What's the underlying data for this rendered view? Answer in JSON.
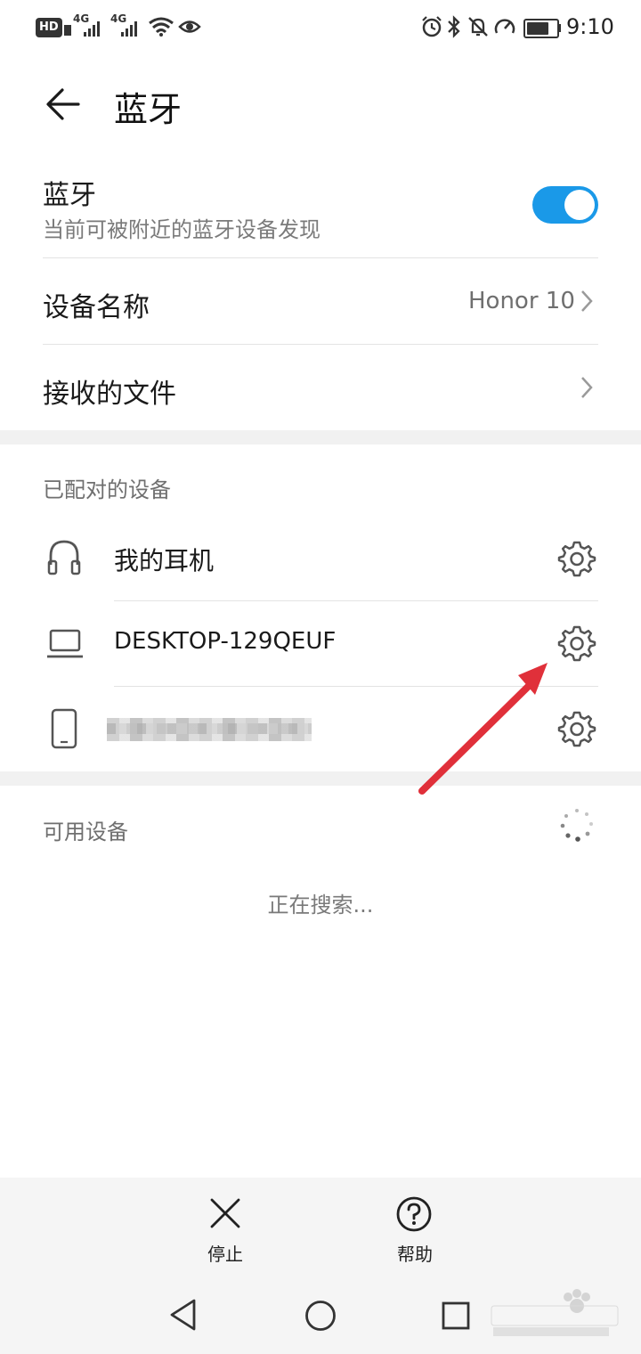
{
  "status_bar": {
    "hd_badge": "HD",
    "signal1_label": "4G",
    "signal2_label": "4G",
    "time": "9:10"
  },
  "header": {
    "title": "蓝牙"
  },
  "bluetooth": {
    "title": "蓝牙",
    "subtitle": "当前可被附近的蓝牙设备发现",
    "enabled": true
  },
  "device_name": {
    "label": "设备名称",
    "value": "Honor 10"
  },
  "received_files": {
    "label": "接收的文件"
  },
  "paired": {
    "section_label": "已配对的设备",
    "devices": [
      {
        "name": "我的耳机",
        "icon": "headphones-icon"
      },
      {
        "name": "DESKTOP-129QEUF",
        "icon": "laptop-icon"
      },
      {
        "name": "",
        "icon": "phone-icon"
      }
    ]
  },
  "available": {
    "section_label": "可用设备",
    "searching_text": "正在搜索..."
  },
  "bottom_actions": {
    "stop_label": "停止",
    "help_label": "帮助"
  },
  "colors": {
    "toggle_on": "#1a99e8",
    "arrow": "#e0303a"
  }
}
